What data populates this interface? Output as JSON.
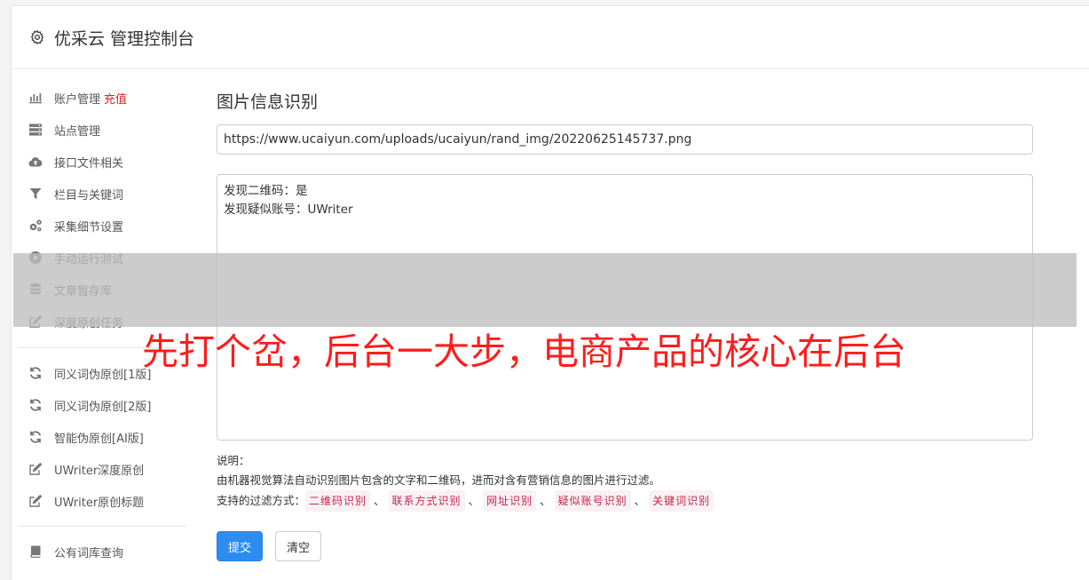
{
  "header": {
    "title": "优采云 管理控制台"
  },
  "sidebar": {
    "group1": [
      {
        "label": "账户管理",
        "icon": "bar-chart-icon",
        "extra": "充值"
      },
      {
        "label": "站点管理",
        "icon": "server-icon"
      },
      {
        "label": "接口文件相关",
        "icon": "cloud-upload-icon"
      },
      {
        "label": "栏目与关键词",
        "icon": "filter-icon"
      },
      {
        "label": "采集细节设置",
        "icon": "cogs-icon"
      },
      {
        "label": "手动运行测试",
        "icon": "play-circle-icon"
      },
      {
        "label": "文章暂存库",
        "icon": "database-icon"
      },
      {
        "label": "深度原创任务",
        "icon": "edit-icon"
      }
    ],
    "group2": [
      {
        "label": "同义词伪原创[1版]",
        "icon": "refresh-icon"
      },
      {
        "label": "同义词伪原创[2版]",
        "icon": "refresh-icon"
      },
      {
        "label": "智能伪原创[AI版]",
        "icon": "refresh-icon"
      },
      {
        "label": "UWriter深度原创",
        "icon": "edit-icon"
      },
      {
        "label": "UWriter原创标题",
        "icon": "edit-icon"
      }
    ],
    "group3": [
      {
        "label": "公有词库查询",
        "icon": "book-icon"
      }
    ]
  },
  "main": {
    "title": "图片信息识别",
    "url_value": "https://www.ucaiyun.com/uploads/ucaiyun/rand_img/20220625145737.png",
    "result_lines": [
      "发现二维码：是",
      "发现疑似账号：UWriter"
    ],
    "notes_label": "说明：",
    "notes_desc": "由机器视觉算法自动识别图片包含的文字和二维码，进而对含有营销信息的图片进行过滤。",
    "filters_label": "支持的过滤方式：",
    "filters": [
      "二维码识别",
      "联系方式识别",
      "网址识别",
      "疑似账号识别",
      "关键词识别"
    ],
    "filter_sep": "、",
    "submit_label": "提交",
    "clear_label": "清空"
  },
  "overlay": {
    "caption": "先打个岔，后台一大步，电商产品的核心在后台"
  },
  "colors": {
    "primary": "#2d8cf0",
    "recharge": "#e02020",
    "tag_text": "#c7254e",
    "tag_bg": "#f9f2f4",
    "caption": "#ff1c1c"
  }
}
